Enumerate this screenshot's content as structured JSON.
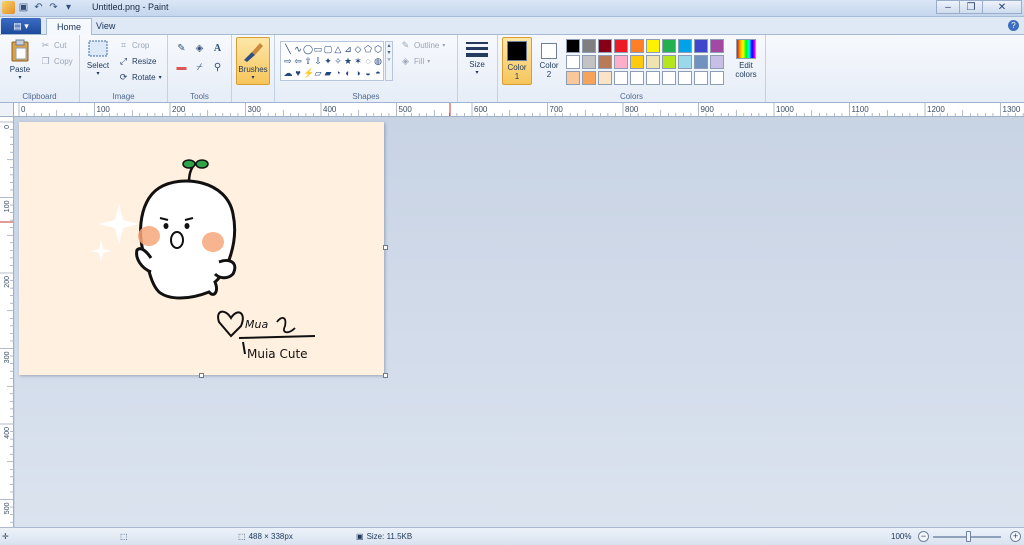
{
  "window": {
    "title": "Untitled.png - Paint",
    "quick_access_icons": [
      "paint-app-icon",
      "save-icon",
      "undo-icon",
      "redo-icon",
      "customize-arrow-icon"
    ],
    "controls": [
      "minimize-icon",
      "maximize-icon",
      "close-icon"
    ]
  },
  "tabs": {
    "menu_label": "▤ ▾",
    "items": [
      {
        "label": "Home",
        "active": true
      },
      {
        "label": "View",
        "active": false
      }
    ]
  },
  "ribbon": {
    "clipboard": {
      "group_label": "Clipboard",
      "paste": "Paste",
      "cut": "Cut",
      "copy": "Copy"
    },
    "image": {
      "group_label": "Image",
      "select": "Select",
      "crop": "Crop",
      "resize": "Resize",
      "rotate": "Rotate"
    },
    "tools": {
      "group_label": "Tools",
      "icons": [
        "pencil-icon",
        "fill-icon",
        "text-icon",
        "eraser-icon",
        "color-picker-icon",
        "magnifier-icon"
      ]
    },
    "brushes": {
      "label": "Brushes"
    },
    "shapes": {
      "group_label": "Shapes",
      "glyphs": [
        "╲",
        "∿",
        "◯",
        "▭",
        "▢",
        "△",
        "⊿",
        "◇",
        "⬠",
        "⬡",
        "⇨",
        "⇦",
        "⇧",
        "⇩",
        "✦",
        "✧",
        "★",
        "✶",
        "◌",
        "◍",
        "☁",
        "♥",
        "⚡",
        "▱",
        "▰",
        "◔",
        "◐",
        "◑",
        "◒",
        "◓"
      ],
      "outline": "Outline",
      "fill": "Fill"
    },
    "size": {
      "label": "Size"
    },
    "colors": {
      "group_label": "Colors",
      "color1_label": "Color\n1",
      "color1_line1": "Color",
      "color1_line2": "1",
      "color2_line1": "Color",
      "color2_line2": "2",
      "color1_value": "#000000",
      "color2_value": "#ffffff",
      "edit_line1": "Edit",
      "edit_line2": "colors",
      "palette": [
        "#000000",
        "#7f7f7f",
        "#880015",
        "#ed1c24",
        "#ff7f27",
        "#fff200",
        "#22b14c",
        "#00a2e8",
        "#3f48cc",
        "#a349a4",
        "#ffffff",
        "#c3c3c3",
        "#b97a57",
        "#ffaec9",
        "#ffc90e",
        "#efe4b0",
        "#b5e61d",
        "#99d9ea",
        "#7092be",
        "#c8bfe7",
        "#f8c89a",
        "#f5a45a",
        "#fbe3c8",
        "#ffffff",
        "#ffffff",
        "#ffffff",
        "#ffffff",
        "#ffffff",
        "#ffffff",
        "#ffffff"
      ]
    }
  },
  "rulers": {
    "horizontal": [
      "0",
      "100",
      "200",
      "300",
      "400",
      "500",
      "600",
      "700",
      "800",
      "900",
      "1000",
      "1100",
      "1200",
      "1300"
    ],
    "vertical": [
      "0",
      "100",
      "200",
      "300",
      "400",
      "500"
    ]
  },
  "canvas": {
    "background": "#fff0e0",
    "signature_text": "Muia Cute",
    "signature_name": "Mua"
  },
  "statusbar": {
    "dimensions": "488 × 338px",
    "size": "Size: 11.5KB",
    "zoom": "100%"
  }
}
